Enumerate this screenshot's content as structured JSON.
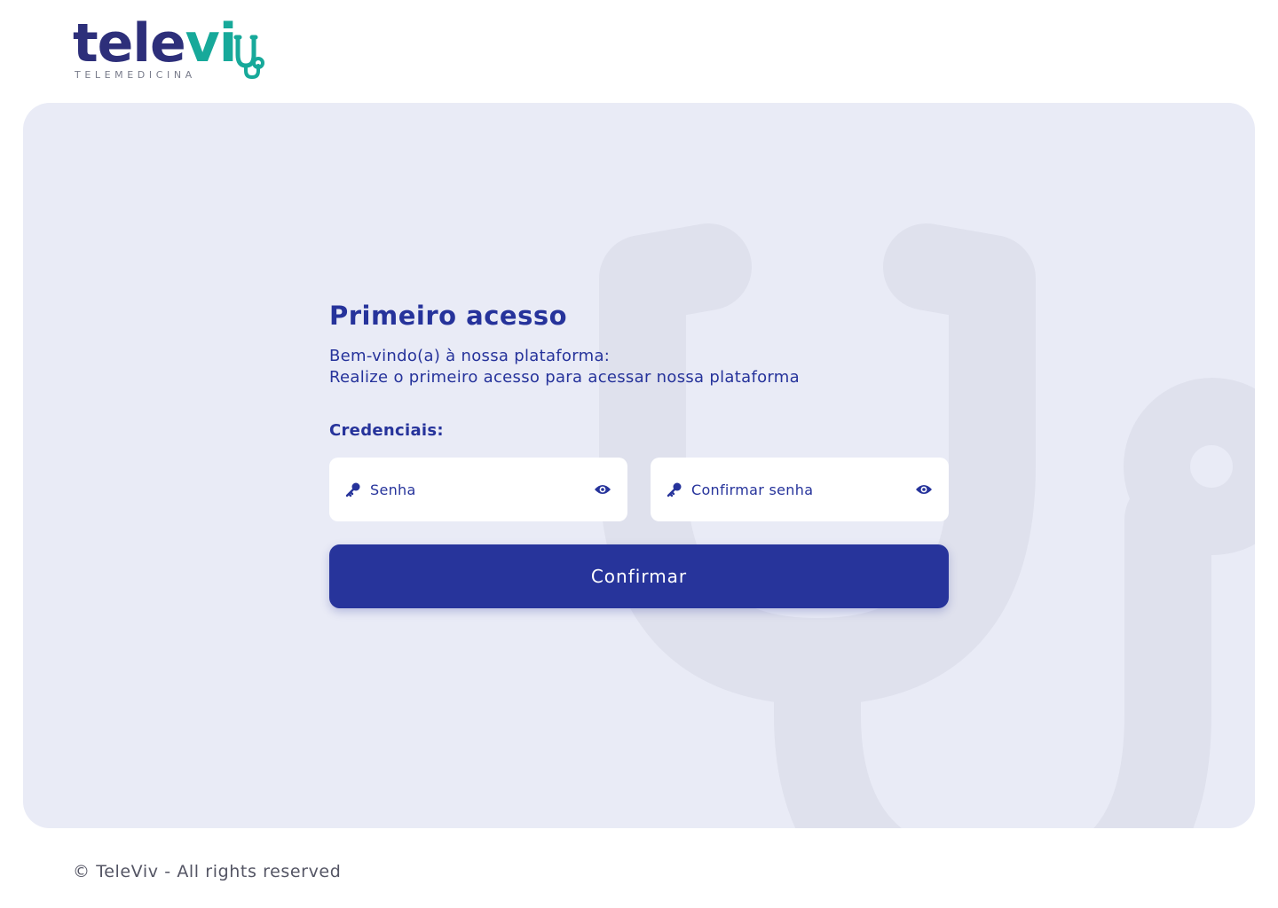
{
  "brand": {
    "name_part1": "tele",
    "name_part2": "vi",
    "tagline": "TELEMEDICINA",
    "primary_color": "#2d2f7a",
    "accent_color": "#17a99a"
  },
  "form": {
    "title": "Primeiro acesso",
    "welcome_line1": "Bem-vindo(a) à nossa plataforma:",
    "welcome_line2": "Realize o primeiro acesso para acessar nossa plataforma",
    "credentials_label": "Credenciais:",
    "password_placeholder": "Senha",
    "password_value": "",
    "confirm_password_placeholder": "Confirmar senha",
    "confirm_password_value": "",
    "field_icon": "key-icon",
    "toggle_icon": "eye-icon",
    "submit_label": "Confirmar",
    "button_color": "#27349b"
  },
  "background": {
    "panel_color": "#e9ebf6",
    "watermark_icon": "stethoscope-icon"
  },
  "footer": {
    "copyright": "© TeleViv - All rights reserved"
  }
}
